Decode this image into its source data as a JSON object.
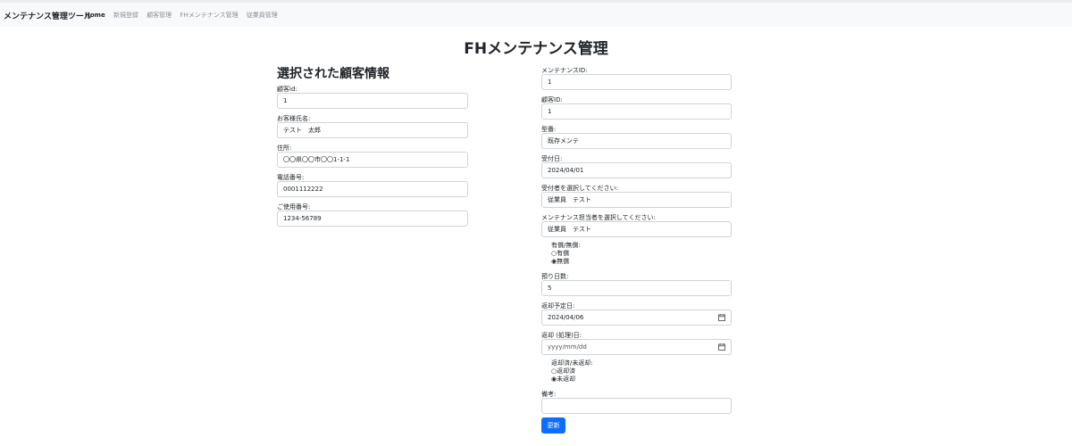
{
  "navbar": {
    "brand": "メンテナンス管理ツール",
    "links": [
      "Home",
      "新規登録",
      "顧客管理",
      "FHメンテナンス管理",
      "従業員管理"
    ]
  },
  "page": {
    "title": "FHメンテナンス管理"
  },
  "customer": {
    "section_title": "選択された顧客情報",
    "fields": [
      {
        "label": "顧客id:",
        "value": "1"
      },
      {
        "label": "お客様氏名:",
        "value": "テスト　太郎"
      },
      {
        "label": "住所:",
        "value": "〇〇県〇〇市〇〇1-1-1"
      },
      {
        "label": "電話番号:",
        "value": "0001112222"
      },
      {
        "label": "ご使用番号:",
        "value": "1234-56789"
      }
    ]
  },
  "maintenance": {
    "fields": [
      {
        "label": "メンテナンスID:",
        "value": "1"
      },
      {
        "label": "顧客ID:",
        "value": "1"
      },
      {
        "label": "型番:",
        "value": "既存メンテ"
      },
      {
        "label": "受付日:",
        "value": "2024/04/01"
      },
      {
        "label": "受付者を選択してください:",
        "value": "従業員　テスト"
      },
      {
        "label": "メンテナンス担当者を選択してください:",
        "value": "従業員　テスト"
      }
    ],
    "paid": {
      "label": "有償/無償:",
      "options": [
        "○有償",
        "◉無償"
      ]
    },
    "days": {
      "label": "預り日数:",
      "value": "5"
    },
    "return_planned": {
      "label": "返却予定日:",
      "value": "2024/04/06"
    },
    "return_actual": {
      "label": "返却 (処理)日:",
      "placeholder": "yyyy/mm/dd"
    },
    "returned": {
      "label": "返却済/未返却:",
      "options": [
        "○返却済",
        "◉未返却"
      ]
    },
    "notes": {
      "label": "備考:",
      "value": ""
    },
    "submit_label": "更新"
  }
}
